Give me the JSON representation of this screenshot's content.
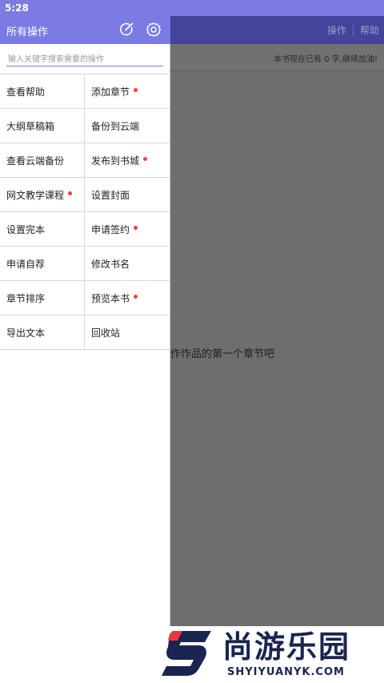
{
  "status_bar": {
    "time": "5:28"
  },
  "background": {
    "header_actions": [
      "操作",
      "帮助"
    ],
    "info_text": "本书现在已有 0 字,继续加油!",
    "empty_text": "作作品的第一个章节吧"
  },
  "drawer": {
    "title": "所有操作",
    "search_placeholder": "输入关键字搜索需要的操作",
    "items": [
      {
        "label": "查看帮助",
        "dot": false
      },
      {
        "label": "添加章节",
        "dot": true
      },
      {
        "label": "大纲草稿箱",
        "dot": false
      },
      {
        "label": "备份到云端",
        "dot": false
      },
      {
        "label": "查看云端备份",
        "dot": false
      },
      {
        "label": "发布到书城",
        "dot": true
      },
      {
        "label": "网文教学课程",
        "dot": true
      },
      {
        "label": "设置封面",
        "dot": false
      },
      {
        "label": "设置完本",
        "dot": false
      },
      {
        "label": "申请签约",
        "dot": true
      },
      {
        "label": "申请自荐",
        "dot": false
      },
      {
        "label": "修改书名",
        "dot": false
      },
      {
        "label": "章节排序",
        "dot": false
      },
      {
        "label": "预览本书",
        "dot": true
      },
      {
        "label": "导出文本",
        "dot": false
      },
      {
        "label": "回收站",
        "dot": false
      }
    ]
  },
  "watermark": {
    "name_cn": "尚游乐园",
    "name_en": "SHYIYUANYK.COM"
  },
  "colors": {
    "primary": "#7b7be3",
    "dot": "#ff3b3b",
    "dim_header": "#44449a"
  }
}
